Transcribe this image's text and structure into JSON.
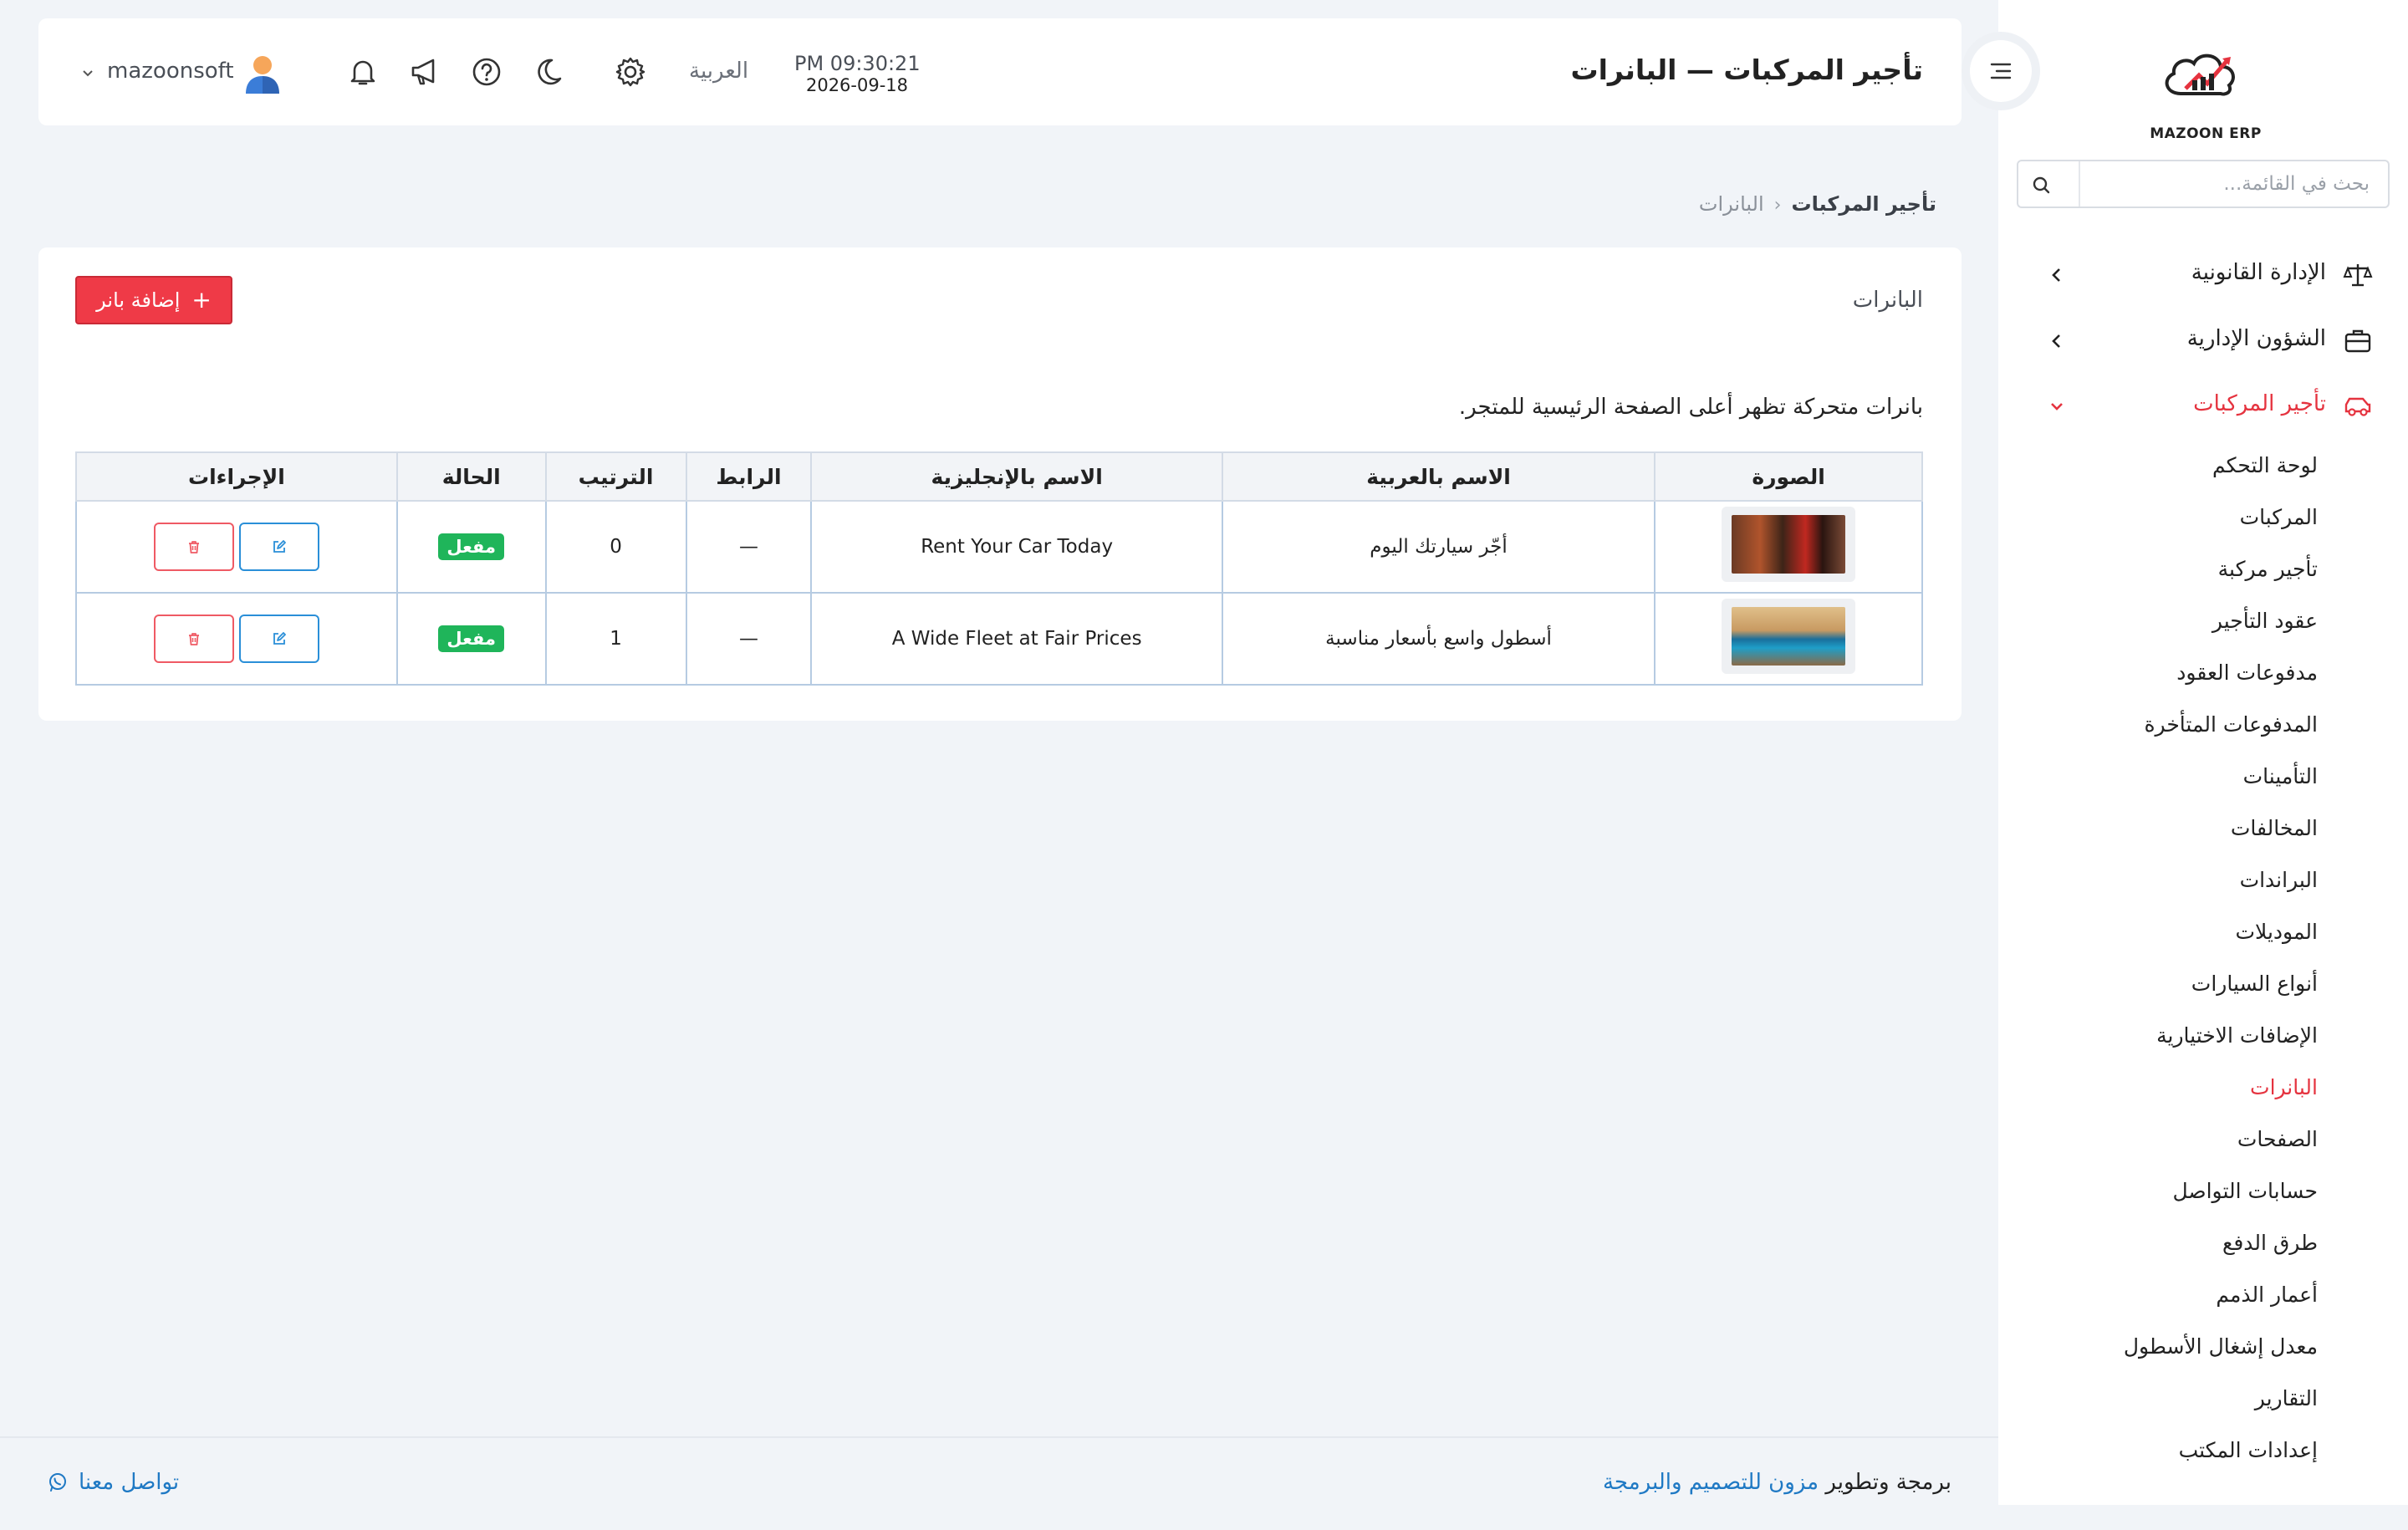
{
  "app": {
    "logo_text": "MAZOON ERP",
    "accent_color": "#e5333f",
    "link_color": "#1f79c4",
    "status_color": "#1fb55a"
  },
  "sidebar": {
    "search_placeholder": "بحث في القائمة...",
    "groups": [
      {
        "label": "الإدارة القانونية",
        "icon": "scales-icon",
        "expanded": false
      },
      {
        "label": "الشؤون الإدارية",
        "icon": "briefcase-icon",
        "expanded": false
      },
      {
        "label": "تأجير المركبات",
        "icon": "car-icon",
        "expanded": true
      }
    ],
    "items": [
      {
        "label": "لوحة التحكم"
      },
      {
        "label": "المركبات"
      },
      {
        "label": "تأجير مركبة"
      },
      {
        "label": "عقود التأجير"
      },
      {
        "label": "مدفوعات العقود"
      },
      {
        "label": "المدفوعات المتأخرة"
      },
      {
        "label": "التأمينات"
      },
      {
        "label": "المخالفات"
      },
      {
        "label": "البراندات"
      },
      {
        "label": "الموديلات"
      },
      {
        "label": "أنواع السيارات"
      },
      {
        "label": "الإضافات الاختيارية"
      },
      {
        "label": "البانرات",
        "active": true
      },
      {
        "label": "الصفحات"
      },
      {
        "label": "حسابات التواصل"
      },
      {
        "label": "طرق الدفع"
      },
      {
        "label": "أعمار الذمم"
      },
      {
        "label": "معدل إشغال الأسطول"
      },
      {
        "label": "التقارير"
      },
      {
        "label": "إعدادات المكتب"
      }
    ]
  },
  "header": {
    "title": "تأجير المركبات — البانرات",
    "time": "PM 09:30:21",
    "date": "2026-09-18",
    "language": "العربية",
    "username": "mazoonsoft"
  },
  "breadcrumb": {
    "root": "تأجير المركبات",
    "current": "البانرات"
  },
  "card": {
    "title": "البانرات",
    "add_button": "إضافة بانر",
    "description": "بانرات متحركة تظهر أعلى الصفحة الرئيسية للمتجر."
  },
  "table": {
    "columns": [
      "الصورة",
      "الاسم بالعربية",
      "الاسم بالإنجليزية",
      "الرابط",
      "الترتيب",
      "الحالة",
      "الإجراءات"
    ],
    "rows": [
      {
        "image": "red-car-photo",
        "name_ar": "أجّر سيارتك اليوم",
        "name_en": "Rent Your Car Today",
        "link": "—",
        "order": "0",
        "status": "مفعل"
      },
      {
        "image": "blue-car-photo",
        "name_ar": "أسطول واسع بأسعار مناسبة",
        "name_en": "A Wide Fleet at Fair Prices",
        "link": "—",
        "order": "1",
        "status": "مفعل"
      }
    ]
  },
  "footer": {
    "credit_prefix": "برمجة وتطوير",
    "credit_brand": "مزون للتصميم والبرمجة",
    "contact": "تواصل معنا"
  }
}
